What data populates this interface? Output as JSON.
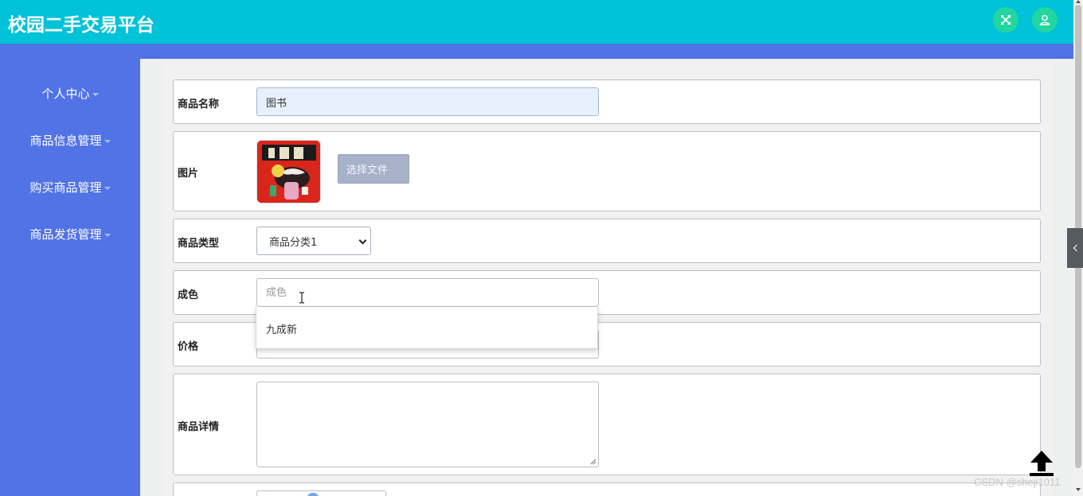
{
  "header": {
    "title": "校园二手交易平台",
    "fullscreen_icon": "fullscreen-icon",
    "user_icon": "user-icon"
  },
  "sidebar": {
    "items": [
      {
        "label": "个人中心"
      },
      {
        "label": "商品信息管理"
      },
      {
        "label": "购买商品管理"
      },
      {
        "label": "商品发货管理"
      }
    ]
  },
  "form": {
    "name": {
      "label": "商品名称",
      "value": "图书"
    },
    "image": {
      "label": "图片",
      "button_label": "选择文件"
    },
    "category": {
      "label": "商品类型",
      "selected": "商品分类1"
    },
    "condition": {
      "label": "成色",
      "placeholder": "成色",
      "suggestions": [
        "九成新"
      ]
    },
    "price": {
      "label": "价格"
    },
    "details": {
      "label": "商品详情"
    }
  },
  "watermark": "CSDN @sheji1011",
  "colors": {
    "header": "#00c2d9",
    "sidebar": "#5173e6",
    "header_button": "#22d6a0",
    "file_button": "#a7b1c9"
  }
}
